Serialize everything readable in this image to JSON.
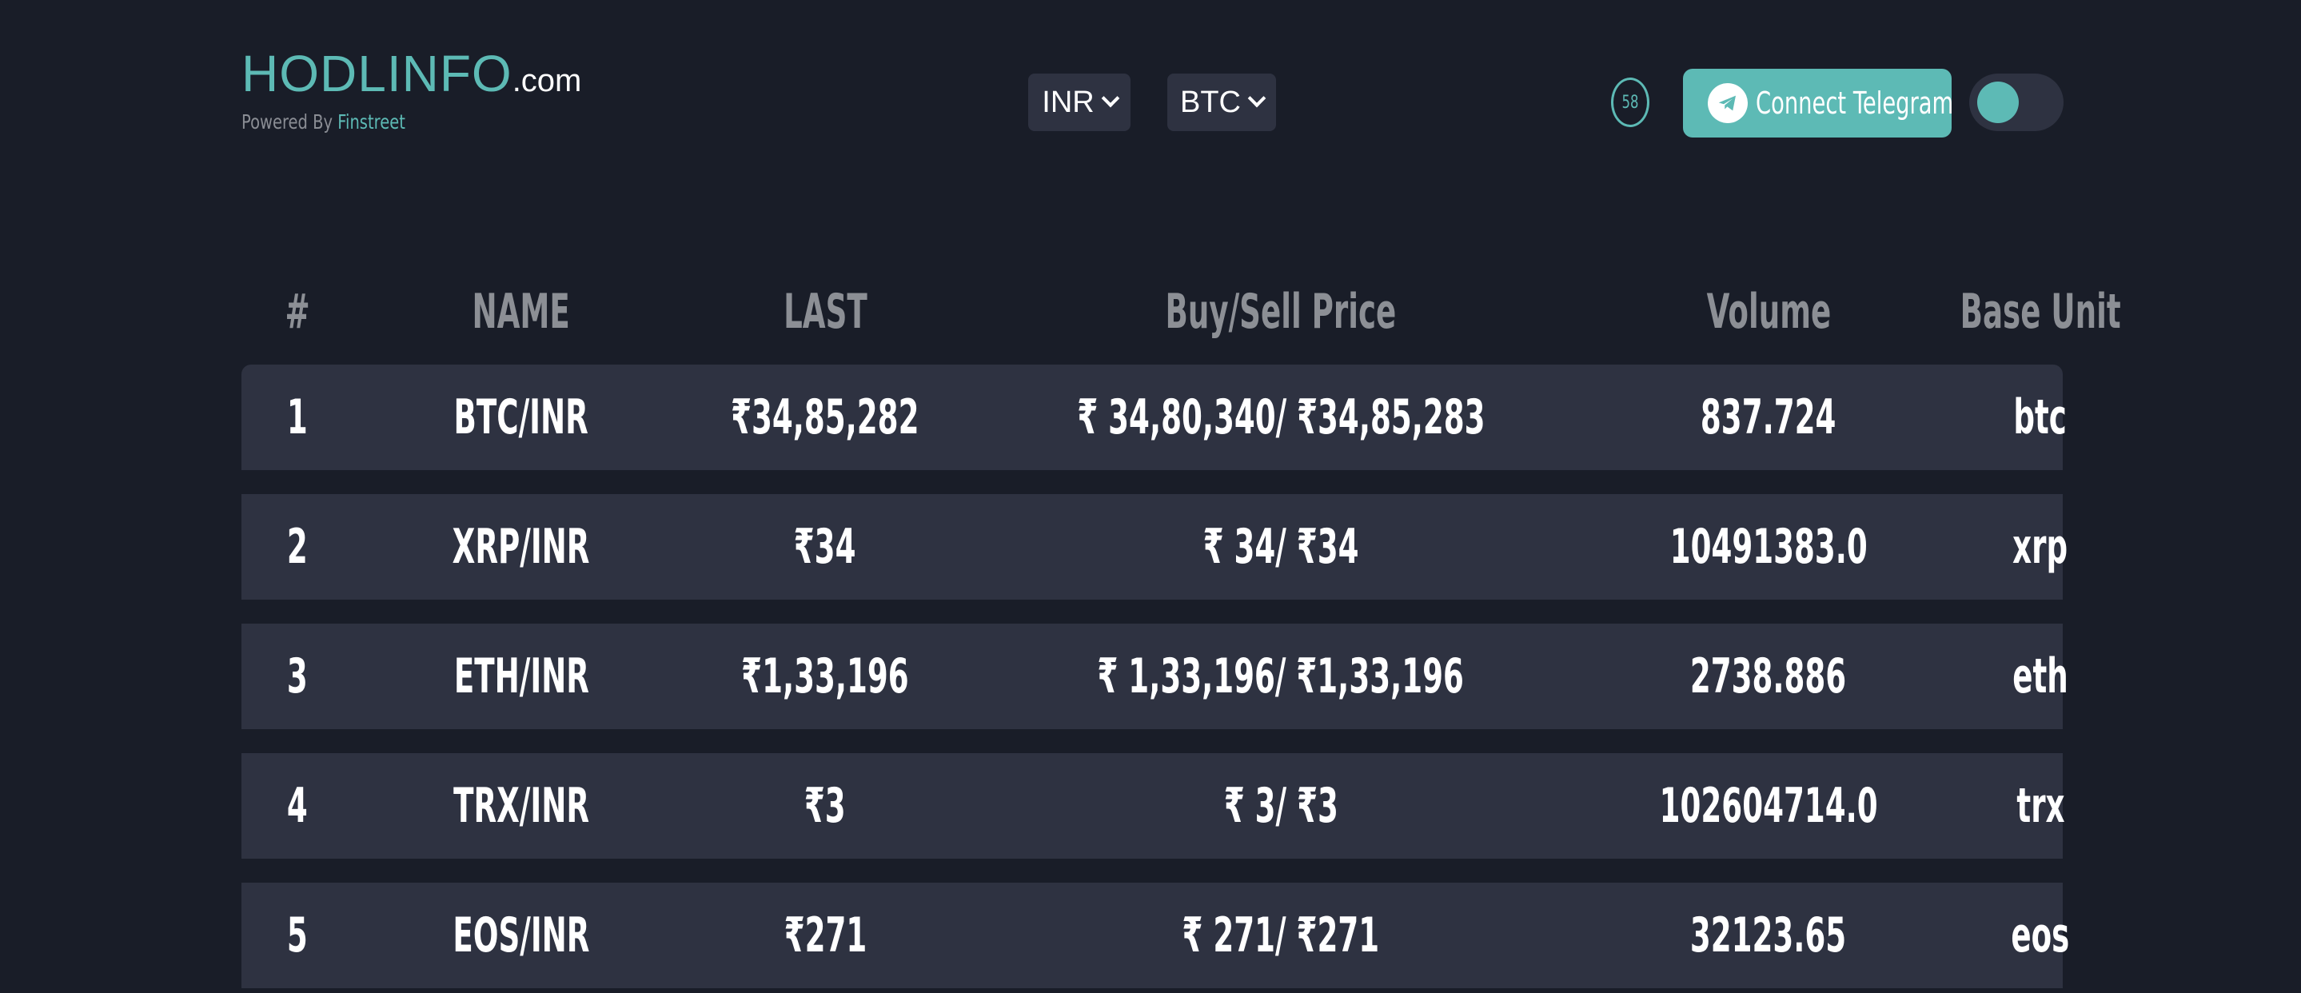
{
  "header": {
    "brand_main": "HODLINFO",
    "brand_suffix": ".com",
    "powered_by": "Powered By",
    "powered_by_link": "Finstreet",
    "currency_select": "INR",
    "coin_select": "BTC",
    "timer_value": "58",
    "telegram_button_label": "Connect Telegram",
    "toggle_state": "on"
  },
  "colors": {
    "background": "#191d28",
    "accent": "#5dbab5",
    "row_background": "#2e3241",
    "header_text": "#8c8f95"
  },
  "table": {
    "columns": [
      "#",
      "NAME",
      "LAST",
      "Buy/Sell Price",
      "Volume",
      "Base Unit"
    ],
    "rows": [
      {
        "num": "1",
        "name": "BTC/INR",
        "last": "₹34,85,282",
        "buy_sell": "₹ 34,80,340/ ₹34,85,283",
        "volume": "837.724",
        "base_unit": "btc"
      },
      {
        "num": "2",
        "name": "XRP/INR",
        "last": "₹34",
        "buy_sell": "₹ 34/ ₹34",
        "volume": "10491383.0",
        "base_unit": "xrp"
      },
      {
        "num": "3",
        "name": "ETH/INR",
        "last": "₹1,33,196",
        "buy_sell": "₹ 1,33,196/ ₹1,33,196",
        "volume": "2738.886",
        "base_unit": "eth"
      },
      {
        "num": "4",
        "name": "TRX/INR",
        "last": "₹3",
        "buy_sell": "₹ 3/ ₹3",
        "volume": "102604714.0",
        "base_unit": "trx"
      },
      {
        "num": "5",
        "name": "EOS/INR",
        "last": "₹271",
        "buy_sell": "₹ 271/ ₹271",
        "volume": "32123.65",
        "base_unit": "eos"
      }
    ]
  }
}
